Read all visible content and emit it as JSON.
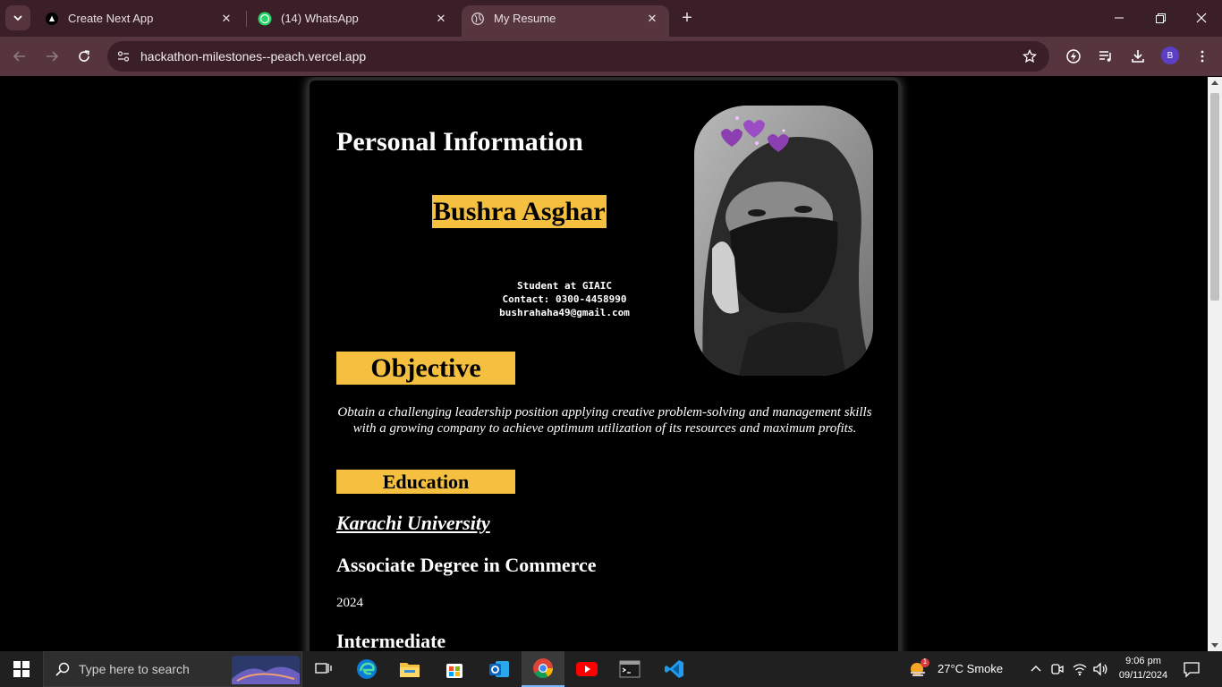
{
  "browser": {
    "tabs": [
      {
        "title": "Create Next App",
        "favicon": "nextjs-icon"
      },
      {
        "title": "(14) WhatsApp",
        "favicon": "whatsapp-icon"
      },
      {
        "title": "My Resume",
        "favicon": "globe-icon",
        "active": true
      }
    ],
    "new_tab_label": "+",
    "url": "hackathon-milestones--peach.vercel.app",
    "profile_initial": "B"
  },
  "resume": {
    "section_title": "Personal Information",
    "name": "Bushra Asghar",
    "contact_lines": [
      "Student at GIAIC",
      "Contact: 0300-4458990",
      "bushrahaha49@gmail.com"
    ],
    "objective_title": "Objective",
    "objective_text": "Obtain a challenging leadership position applying creative problem-solving and management skills with a growing company to achieve optimum utilization of its resources and maximum profits.",
    "education_title": "Education",
    "education": [
      {
        "school": "Karachi University",
        "degree": "Associate Degree in Commerce",
        "year": "2024"
      },
      {
        "degree": "Intermediate"
      }
    ]
  },
  "taskbar": {
    "search_placeholder": "Type here to search",
    "weather": "27°C  Smoke",
    "weather_badge": "1",
    "time": "9:06 pm",
    "date": "09/11/2024"
  },
  "colors": {
    "tab_bg": "#3b1f28",
    "toolbar_bg": "#56353e",
    "badge_yellow": "#f5c040",
    "page_bg": "#000000"
  }
}
